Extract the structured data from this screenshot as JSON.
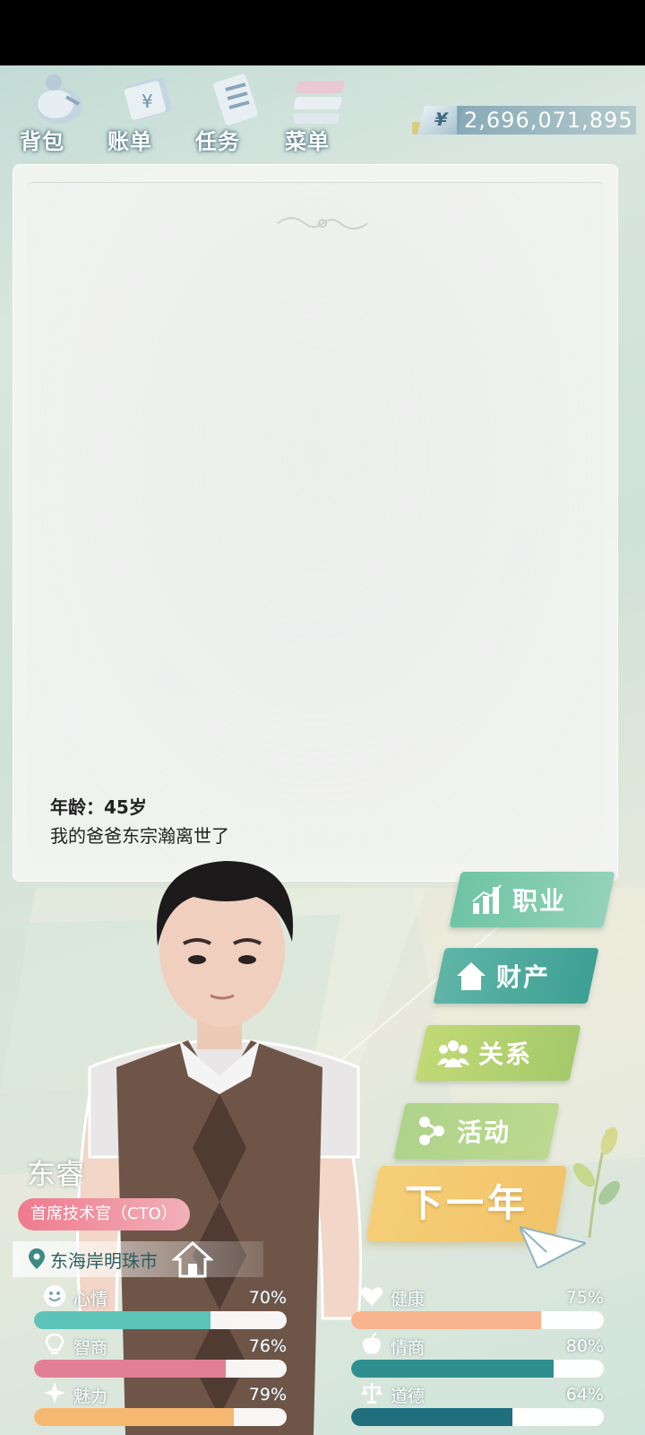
{
  "nav": {
    "bag": "背包",
    "bill": "账单",
    "task": "任务",
    "menu": "菜单"
  },
  "money": {
    "symbol": "¥",
    "value": "2,696,071,895"
  },
  "story": {
    "age_line": "年龄：45岁",
    "event_line": "我的爸爸东宗瀚离世了"
  },
  "actions": {
    "career": "职业",
    "assets": "财产",
    "relation": "关系",
    "activity": "活动",
    "next_year": "下一年"
  },
  "character": {
    "name": "东睿",
    "job": "首席技术官（CTO）",
    "location": "东海岸明珠市"
  },
  "stats": [
    {
      "label": "心情",
      "value": "70%",
      "fill": 0.7,
      "color": "#5cc3b8",
      "icon": "smile-icon"
    },
    {
      "label": "健康",
      "value": "75%",
      "fill": 0.75,
      "color": "#f7b48e",
      "icon": "heart-icon"
    },
    {
      "label": "智商",
      "value": "76%",
      "fill": 0.76,
      "color": "#e27f95",
      "icon": "lightbulb-icon"
    },
    {
      "label": "情商",
      "value": "80%",
      "fill": 0.8,
      "color": "#2f8f8e",
      "icon": "apple-icon"
    },
    {
      "label": "魅力",
      "value": "79%",
      "fill": 0.79,
      "color": "#f6b870",
      "icon": "sparkle-icon"
    },
    {
      "label": "道德",
      "value": "64%",
      "fill": 0.64,
      "color": "#1f6f7e",
      "icon": "scale-icon"
    }
  ]
}
